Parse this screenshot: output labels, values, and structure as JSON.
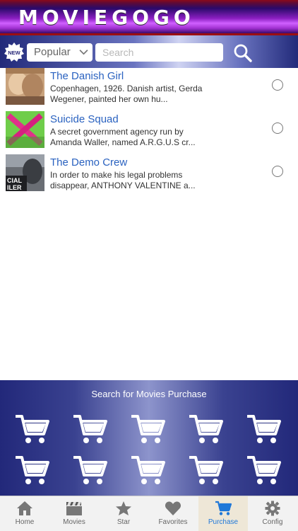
{
  "app": {
    "brand": "MOVIEGOGO"
  },
  "toolbar": {
    "badge": "NEW",
    "sort_selected": "Popular",
    "search_placeholder": "Search",
    "colors": {
      "accent": "#2a62c0"
    }
  },
  "movies": [
    {
      "title": "The Danish Girl",
      "desc": "Copenhagen, 1926. Danish artist, Gerda Wegener, painted her own hu..."
    },
    {
      "title": "Suicide Squad",
      "desc": "A secret government agency run by Amanda Waller, named A.R.G.U.S cr..."
    },
    {
      "title": "The Demo Crew",
      "desc": "In order to make his legal problems disappear, ANTHONY VALENTINE a..."
    }
  ],
  "purchase": {
    "title": "Search for Movies Purchase",
    "icon": "shopping-cart-icon"
  },
  "tabs": [
    {
      "label": "Home",
      "icon": "home-icon"
    },
    {
      "label": "Movies",
      "icon": "clapperboard-icon"
    },
    {
      "label": "Star",
      "icon": "star-icon"
    },
    {
      "label": "Favorites",
      "icon": "heart-icon"
    },
    {
      "label": "Purchase",
      "icon": "shopping-cart-icon"
    },
    {
      "label": "Config",
      "icon": "gear-icon"
    }
  ]
}
